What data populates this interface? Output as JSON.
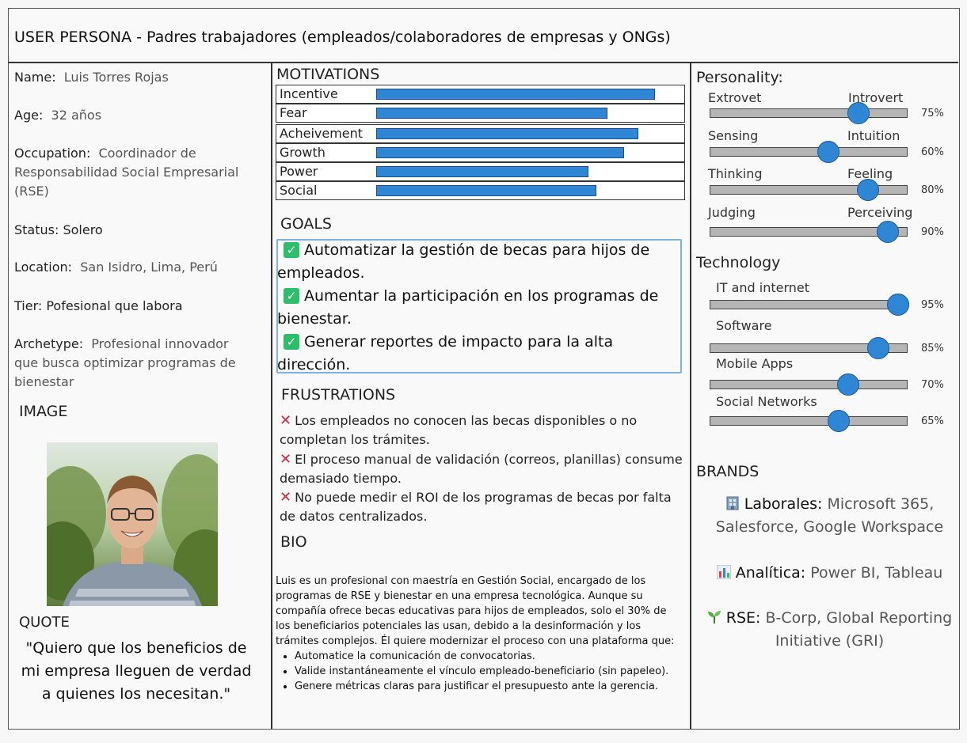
{
  "title": "USER PERSONA -  Padres trabajadores (empleados/colaboradores de empresas y ONGs)",
  "profile": {
    "name_label": "Name:",
    "name_value": "Luis Torres Rojas",
    "age_label": "Age:",
    "age_value": "32 años",
    "occupation_label": "Occupation:",
    "occupation_value": "Coordinador de Responsabilidad Social Empresarial (RSE)",
    "status": "Status: Solero",
    "location_label": "Location:",
    "location_value": "San Isidro, Lima, Perú",
    "tier": "Tier: Pofesional que labora",
    "archetype_label": "Archetype:",
    "archetype_value": "Profesional innovador que busca optimizar programas de bienestar",
    "image_header": "IMAGE",
    "quote_header": "QUOTE",
    "quote": "\"Quiero que los beneficios de mi empresa lleguen de verdad a quienes los necesitan.\""
  },
  "motivations": {
    "header": "MOTIVATIONS",
    "items": [
      {
        "label": "Incentive",
        "value": 1.0
      },
      {
        "label": "Fear",
        "value": 0.83
      },
      {
        "label": "Acheivement",
        "value": 0.94
      },
      {
        "label": "Growth",
        "value": 0.89
      },
      {
        "label": "Power",
        "value": 0.76
      },
      {
        "label": "Social",
        "value": 0.79
      }
    ]
  },
  "goals": {
    "header": "GOALS",
    "items": [
      "Automatizar la gestión de becas para hijos de empleados.",
      "Aumentar la participación en los programas de bienestar.",
      "Generar reportes de impacto para la alta dirección."
    ]
  },
  "frustrations": {
    "header": "FRUSTRATIONS",
    "items": [
      "Los empleados no conocen las becas disponibles o no completan los trámites.",
      "El proceso manual de validación (correos, planillas) consume demasiado tiempo.",
      "No puede medir el ROI de los programas de becas por falta de datos centralizados."
    ]
  },
  "bio": {
    "header": "BIO",
    "text": "Luis es un profesional con maestría en Gestión Social, encargado de los programas de RSE y bienestar en una empresa tecnológica. Aunque su compañía ofrece becas educativas para hijos de empleados, solo el 30% de los beneficiarios potenciales las usan, debido a la desinformación y los trámites complejos. Él quiere modernizar el proceso con una plataforma que:",
    "bullets": [
      "Automatice la comunicación de convocatorias.",
      "Valide instantáneamente el vínculo empleado-beneficiario (sin papeleo).",
      "Genere métricas claras para justificar el presupuesto ante la gerencia."
    ]
  },
  "personality": {
    "header": "Personality:",
    "items": [
      {
        "left": "Extrovet",
        "right": "Introvert",
        "pct": "75%",
        "value": 0.75
      },
      {
        "left": "Sensing",
        "right": "Intuition",
        "pct": "60%",
        "value": 0.6
      },
      {
        "left": "Thinking",
        "right": "Feeling",
        "pct": "80%",
        "value": 0.8
      },
      {
        "left": "Judging",
        "right": "Perceiving",
        "pct": "90%",
        "value": 0.9
      }
    ]
  },
  "technology": {
    "header": "Technology",
    "items": [
      {
        "label": "IT and internet",
        "pct": "95%",
        "value": 0.95
      },
      {
        "label": "Software",
        "pct": "85%",
        "value": 0.85
      },
      {
        "label": "Mobile Apps",
        "pct": "70%",
        "value": 0.7
      },
      {
        "label": "Social Networks",
        "pct": "65%",
        "value": 0.65
      }
    ]
  },
  "brands": {
    "header": "BRANDS",
    "items": [
      {
        "icon": "office-building-icon",
        "label": "Laborales:",
        "value": "Microsoft 365, Salesforce, Google Workspace"
      },
      {
        "icon": "bar-chart-icon",
        "label": "Analítica:",
        "value": "Power BI, Tableau"
      },
      {
        "icon": "seedling-icon",
        "label": "RSE:",
        "value": "B-Corp, Global Reporting Initiative (GRI)"
      }
    ]
  },
  "colors": {
    "accent": "#2f86d4",
    "check": "#2ebd6b",
    "cross": "#e0243a",
    "goals_border": "#7db2e4"
  }
}
